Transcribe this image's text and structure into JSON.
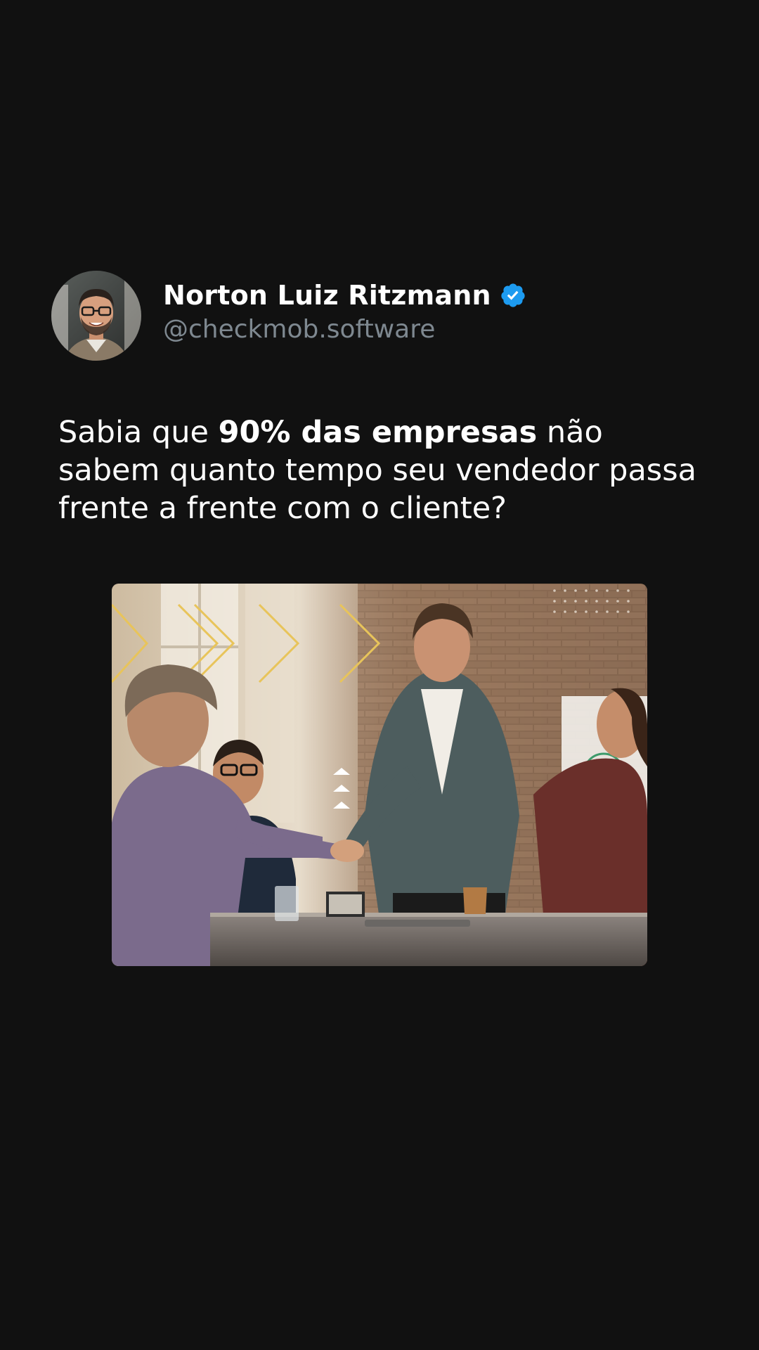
{
  "post": {
    "author": {
      "name": "Norton Luiz Ritzmann",
      "handle": "@checkmob.software",
      "verified_icon": "verified-badge-icon",
      "avatar_icon": "avatar"
    },
    "text": {
      "part1": "Sabia que ",
      "bold": "90% das empresas",
      "part2": " não sabem quanto tempo seu vendedor passa frente a frente com o cliente?"
    },
    "image": {
      "subject": "business-handshake-photo"
    }
  },
  "colors": {
    "background": "#111111",
    "text": "#ffffff",
    "handle": "#7e8890",
    "verified": "#1d9bf0",
    "accent_chevrons": "#e8c45a"
  }
}
